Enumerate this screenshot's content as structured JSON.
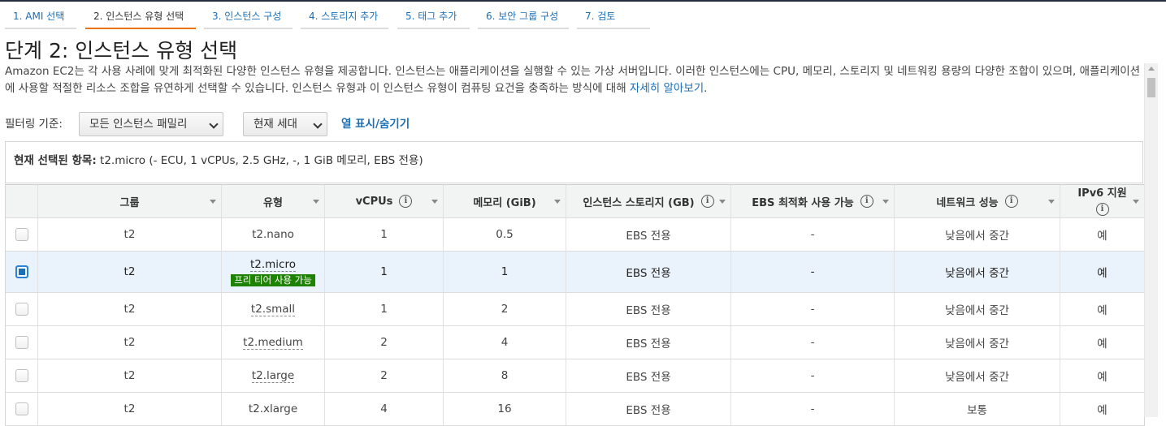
{
  "steps": [
    {
      "label": "1. AMI 선택"
    },
    {
      "label": "2. 인스턴스 유형 선택"
    },
    {
      "label": "3. 인스턴스 구성"
    },
    {
      "label": "4. 스토리지 추가"
    },
    {
      "label": "5. 태그 추가"
    },
    {
      "label": "6. 보안 그룹 구성"
    },
    {
      "label": "7. 검토"
    }
  ],
  "page": {
    "title": "단계 2: 인스턴스 유형 선택",
    "description": "Amazon EC2는 각 사용 사례에 맞게 최적화된 다양한 인스턴스 유형을 제공합니다. 인스턴스는 애플리케이션을 실행할 수 있는 가상 서버입니다. 이러한 인스턴스에는 CPU, 메모리, 스토리지 및 네트워킹 용량의 다양한 조합이 있으며, 애플리케이션에 사용할 적절한 리소스 조합을 유연하게 선택할 수 있습니다. 인스턴스 유형과 이 인스턴스 유형이 컴퓨팅 요건을 충족하는 방식에 대해 ",
    "learn_more": "자세히 알아보기",
    "period": "."
  },
  "filter": {
    "label": "필터링 기준:",
    "family_select": "모든 인스턴스 패밀리",
    "generation_select": "현재 세대",
    "toggle_columns": "열 표시/숨기기"
  },
  "selected": {
    "label": "현재 선택된 항목:",
    "value": "t2.micro (- ECU, 1 vCPUs, 2.5 GHz, -, 1 GiB 메모리, EBS 전용)"
  },
  "table": {
    "headers": {
      "group": "그룹",
      "type": "유형",
      "vcpus": "vCPUs",
      "memory": "메모리 (GiB)",
      "storage": "인스턴스 스토리지 (GB)",
      "ebs": "EBS 최적화 사용 가능",
      "network": "네트워크 성능",
      "ipv6": "IPv6 지원"
    },
    "info_glyph": "i",
    "free_tier_badge": "프리 티어 사용 가능",
    "rows": [
      {
        "group": "t2",
        "type": "t2.nano",
        "vcpus": "1",
        "memory": "0.5",
        "storage": "EBS 전용",
        "ebs": "-",
        "network": "낮음에서 중간",
        "ipv6": "예",
        "selected": false
      },
      {
        "group": "t2",
        "type": "t2.micro",
        "vcpus": "1",
        "memory": "1",
        "storage": "EBS 전용",
        "ebs": "-",
        "network": "낮음에서 중간",
        "ipv6": "예",
        "selected": true
      },
      {
        "group": "t2",
        "type": "t2.small",
        "vcpus": "1",
        "memory": "2",
        "storage": "EBS 전용",
        "ebs": "-",
        "network": "낮음에서 중간",
        "ipv6": "예",
        "selected": false
      },
      {
        "group": "t2",
        "type": "t2.medium",
        "vcpus": "2",
        "memory": "4",
        "storage": "EBS 전용",
        "ebs": "-",
        "network": "낮음에서 중간",
        "ipv6": "예",
        "selected": false
      },
      {
        "group": "t2",
        "type": "t2.large",
        "vcpus": "2",
        "memory": "8",
        "storage": "EBS 전용",
        "ebs": "-",
        "network": "낮음에서 중간",
        "ipv6": "예",
        "selected": false
      },
      {
        "group": "t2",
        "type": "t2.xlarge",
        "vcpus": "4",
        "memory": "16",
        "storage": "EBS 전용",
        "ebs": "-",
        "network": "보통",
        "ipv6": "예",
        "selected": false
      }
    ]
  },
  "colors": {
    "link": "#1a6fb6",
    "active_step_underline": "#ec7211",
    "free_tier_badge": "#1d8102",
    "selected_row_bg": "#eaf2fb"
  }
}
